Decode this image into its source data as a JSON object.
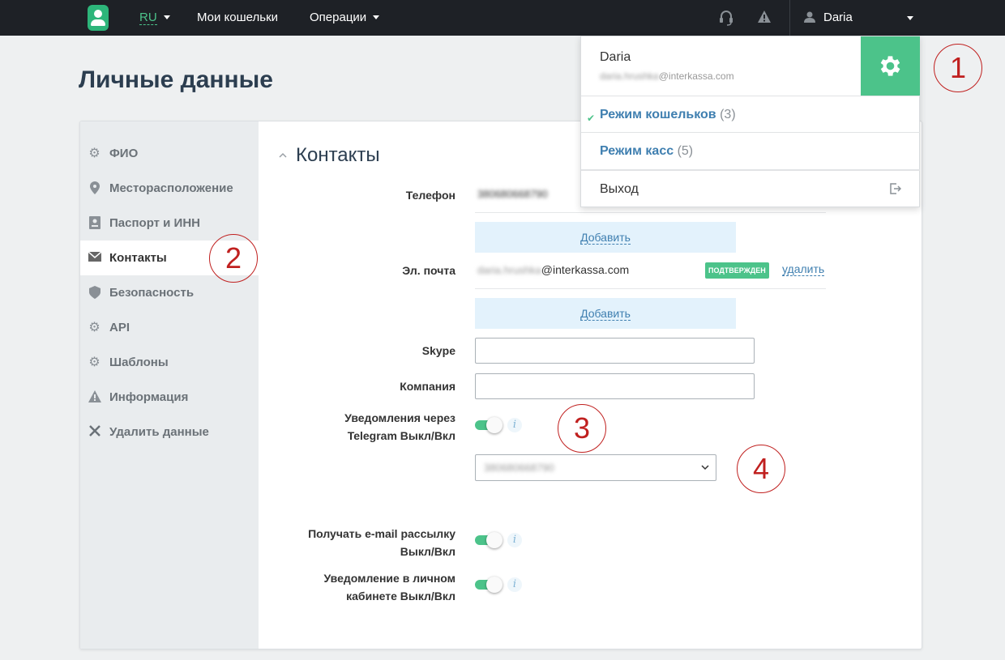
{
  "nav": {
    "lang": "RU",
    "wallets": "Мои кошельки",
    "operations": "Операции",
    "user": "Daria"
  },
  "page": {
    "title": "Личные данные"
  },
  "sidebar": {
    "items": [
      {
        "label": "ФИО",
        "icon": "gear-icon"
      },
      {
        "label": "Месторасположение",
        "icon": "location-pin-icon"
      },
      {
        "label": "Паспорт и ИНН",
        "icon": "passport-icon"
      },
      {
        "label": "Контакты",
        "icon": "envelope-icon",
        "active": true
      },
      {
        "label": "Безопасность",
        "icon": "shield-icon"
      },
      {
        "label": "API",
        "icon": "gear-icon"
      },
      {
        "label": "Шаблоны",
        "icon": "gear-icon"
      },
      {
        "label": "Информация",
        "icon": "warning-icon"
      },
      {
        "label": "Удалить данные",
        "icon": "close-icon"
      }
    ]
  },
  "contacts": {
    "title": "Контакты",
    "phone_label": "Телефон",
    "phone_value": "380680668790",
    "add_label": "Добавить",
    "email_label": "Эл. почта",
    "email_user": "daria.hrushka",
    "email_domain": "@interkassa.com",
    "confirmed_badge": "ПОДТВЕРЖДЕН",
    "delete_link": "удалить",
    "skype_label": "Skype",
    "skype_value": "",
    "company_label": "Компания",
    "company_value": "",
    "telegram_label_1": "Уведомления через",
    "telegram_label_2": "Telegram Выкл/Вкл",
    "telegram_select_value": "380680668790",
    "email_news_label_1": "Получать e-mail рассылку",
    "email_news_label_2": "Выкл/Вкл",
    "cabinet_label_1": "Уведомление в личном",
    "cabinet_label_2": "кабинете Выкл/Вкл",
    "info_glyph": "i"
  },
  "dropdown": {
    "name": "Daria",
    "email_user": "daria.hrushka",
    "email_domain": "@interkassa.com",
    "mode_wallets": "Режим кошельков",
    "mode_wallets_count": "(3)",
    "mode_cash": "Режим касс",
    "mode_cash_count": "(5)",
    "exit": "Выход"
  },
  "annotations": [
    "1",
    "2",
    "3",
    "4"
  ],
  "colors": {
    "accent": "#4cc38a",
    "link": "#3f7fb0",
    "topbar": "#1e2126",
    "annotation": "#c0201f"
  }
}
